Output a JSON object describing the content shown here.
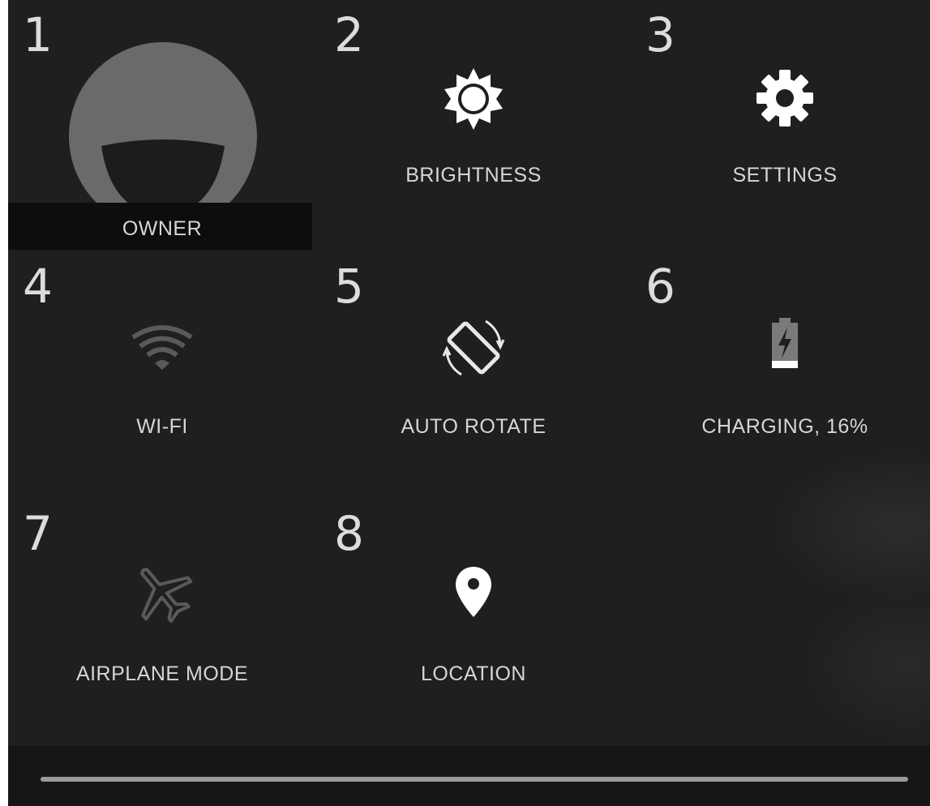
{
  "quick_settings": {
    "tiles": [
      {
        "number": "1",
        "label": "OWNER",
        "icon": "user-avatar-icon"
      },
      {
        "number": "2",
        "label": "BRIGHTNESS",
        "icon": "brightness-sun-icon"
      },
      {
        "number": "3",
        "label": "SETTINGS",
        "icon": "gear-icon"
      },
      {
        "number": "4",
        "label": "WI-FI",
        "icon": "wifi-icon"
      },
      {
        "number": "5",
        "label": "AUTO ROTATE",
        "icon": "auto-rotate-icon"
      },
      {
        "number": "6",
        "label": "CHARGING, 16%",
        "icon": "battery-charging-icon"
      },
      {
        "number": "7",
        "label": "AIRPLANE MODE",
        "icon": "airplane-icon"
      },
      {
        "number": "8",
        "label": "LOCATION",
        "icon": "location-pin-icon"
      }
    ]
  },
  "colors": {
    "background": "#1f1f1f",
    "icon_active": "#ffffff",
    "icon_inactive": "#5a5a5a",
    "avatar": "#6a6a6a"
  }
}
